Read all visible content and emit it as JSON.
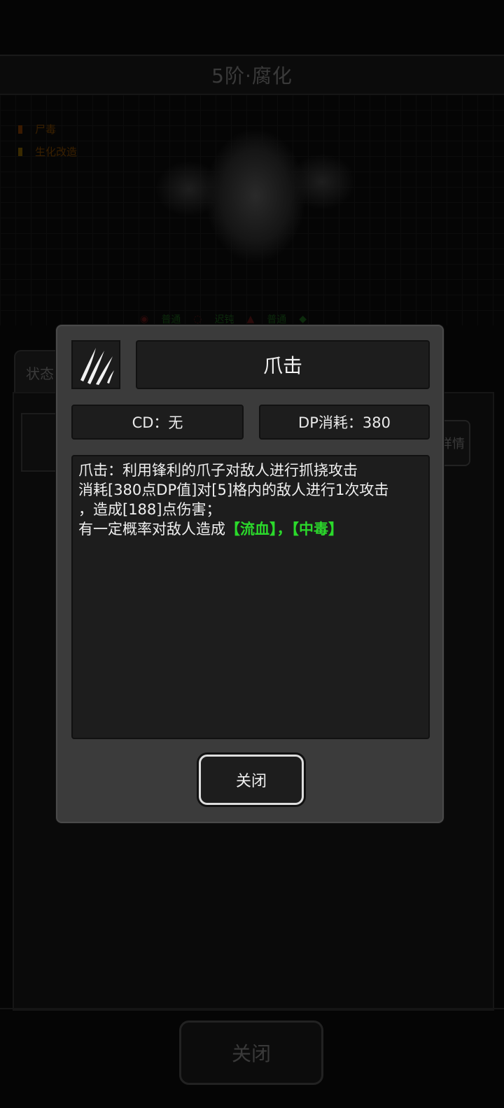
{
  "background": {
    "title": "5阶·腐化",
    "tags": [
      "尸毒",
      "生化改造"
    ],
    "attributes": [
      "普通",
      "迟钝",
      "普通"
    ],
    "tab_label": "状态",
    "detail_button": "详情",
    "close_button": "关闭"
  },
  "dialog": {
    "skill_name": "爪击",
    "skill_icon": "claw-scratch-icon",
    "cd_text": "CD：无",
    "dp_text": "DP消耗：380",
    "description": {
      "line1": "爪击：利用锋利的爪子对敌人进行抓挠攻击",
      "line2": "消耗[380点DP值]对[5]格内的敌人进行1次攻击",
      "line3": "，造成[188]点伤害；",
      "line4_prefix": "有一定概率对敌人造成",
      "status1": "【流血】",
      "separator": "，",
      "status2": "【中毒】"
    },
    "close_button": "关闭"
  },
  "colors": {
    "dialog_bg": "#3b3b3b",
    "box_bg": "#1d1d1d",
    "highlight_green": "#2bd92b"
  }
}
